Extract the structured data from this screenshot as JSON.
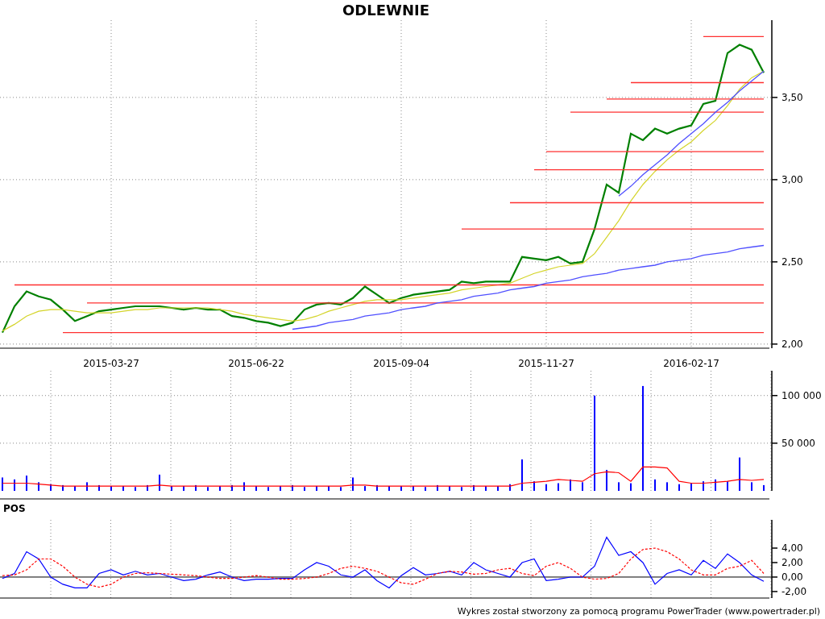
{
  "price_panel": {
    "chart_data": {
      "type": "line",
      "title": "ODLEWNIE",
      "grid": true,
      "categories": [
        null,
        null,
        null,
        null,
        null,
        null,
        null,
        null,
        null,
        "2015-03-27",
        null,
        null,
        null,
        null,
        null,
        null,
        null,
        null,
        null,
        null,
        null,
        "2015-06-22",
        null,
        null,
        null,
        null,
        null,
        null,
        null,
        null,
        null,
        null,
        null,
        "2015-09-04",
        null,
        null,
        null,
        null,
        null,
        null,
        null,
        null,
        null,
        null,
        null,
        "2015-11-27",
        null,
        null,
        null,
        null,
        null,
        null,
        null,
        null,
        null,
        null,
        null,
        "2016-02-17",
        null,
        null,
        null,
        null,
        null,
        null
      ],
      "ylim": [
        1.975,
        3.97
      ],
      "yticks": [
        {
          "value": 2,
          "label": "2,00"
        },
        {
          "value": 2.5,
          "label": "2,50"
        },
        {
          "value": 3,
          "label": "3,00"
        },
        {
          "value": 3.5,
          "label": "3,50"
        }
      ],
      "series": [
        {
          "color": "#008000",
          "values": [
            2.07,
            2.23,
            2.32,
            2.29,
            2.27,
            2.21,
            2.14,
            2.17,
            2.2,
            2.21,
            2.22,
            2.23,
            2.23,
            2.23,
            2.22,
            2.21,
            2.22,
            2.21,
            2.21,
            2.17,
            2.16,
            2.14,
            2.13,
            2.11,
            2.13,
            2.21,
            2.24,
            2.25,
            2.24,
            2.28,
            2.35,
            2.3,
            2.25,
            2.28,
            2.3,
            2.31,
            2.32,
            2.33,
            2.38,
            2.37,
            2.38,
            2.38,
            2.38,
            2.53,
            2.52,
            2.51,
            2.53,
            2.49,
            2.5,
            2.7,
            2.97,
            2.92,
            3.28,
            3.24,
            3.31,
            3.28,
            3.31,
            3.33,
            3.46,
            3.48,
            3.77,
            3.82,
            3.79,
            3.65
          ]
        },
        {
          "color": "#d4d42a",
          "values": [
            2.08,
            2.12,
            2.17,
            2.2,
            2.21,
            2.21,
            2.2,
            2.19,
            2.19,
            2.19,
            2.2,
            2.21,
            2.21,
            2.22,
            2.22,
            2.22,
            2.22,
            2.22,
            2.21,
            2.2,
            2.18,
            2.17,
            2.16,
            2.15,
            2.14,
            2.15,
            2.17,
            2.2,
            2.22,
            2.24,
            2.26,
            2.27,
            2.27,
            2.27,
            2.28,
            2.29,
            2.3,
            2.31,
            2.33,
            2.34,
            2.35,
            2.36,
            2.37,
            2.4,
            2.43,
            2.45,
            2.47,
            2.48,
            2.49,
            2.55,
            2.65,
            2.75,
            2.87,
            2.97,
            3.05,
            3.12,
            3.18,
            3.23,
            3.3,
            3.36,
            3.45,
            3.55,
            3.62,
            3.66
          ]
        },
        {
          "color": "#ff3030",
          "values": [
            null,
            null,
            null,
            null,
            null,
            null,
            null,
            null,
            null,
            null,
            null,
            null,
            null,
            null,
            null,
            null,
            null,
            null,
            null,
            null,
            null,
            null,
            null,
            null,
            null,
            null,
            null,
            null,
            null,
            null,
            null,
            null,
            null,
            null,
            null,
            null,
            null,
            null,
            null,
            null,
            null,
            null,
            null,
            null,
            null,
            null,
            null,
            null,
            null,
            null,
            null,
            null,
            null,
            null,
            null,
            null,
            null,
            null,
            3.87,
            3.87,
            3.87,
            3.87,
            3.87,
            3.87
          ]
        },
        {
          "color": "#ff3030",
          "values": [
            null,
            null,
            null,
            null,
            null,
            null,
            null,
            null,
            null,
            null,
            null,
            null,
            null,
            null,
            null,
            null,
            null,
            null,
            null,
            null,
            null,
            null,
            null,
            null,
            null,
            null,
            null,
            null,
            null,
            null,
            null,
            null,
            null,
            null,
            null,
            null,
            null,
            null,
            null,
            null,
            null,
            null,
            null,
            null,
            null,
            null,
            null,
            null,
            null,
            null,
            null,
            null,
            3.59,
            3.59,
            3.59,
            3.59,
            3.59,
            3.59,
            3.59,
            3.59,
            3.59,
            3.59,
            3.59,
            3.59
          ]
        },
        {
          "color": "#ff3030",
          "values": [
            null,
            null,
            null,
            null,
            null,
            null,
            null,
            null,
            null,
            null,
            null,
            null,
            null,
            null,
            null,
            null,
            null,
            null,
            null,
            null,
            null,
            null,
            null,
            null,
            null,
            null,
            null,
            null,
            null,
            null,
            null,
            null,
            null,
            null,
            null,
            null,
            null,
            null,
            null,
            null,
            null,
            null,
            null,
            null,
            null,
            null,
            null,
            null,
            null,
            null,
            3.49,
            3.49,
            3.49,
            3.49,
            3.49,
            3.49,
            3.49,
            3.49,
            3.49,
            3.49,
            3.49,
            3.49,
            3.49,
            3.49
          ]
        },
        {
          "color": "#ff3030",
          "values": [
            null,
            null,
            null,
            null,
            null,
            null,
            null,
            null,
            null,
            null,
            null,
            null,
            null,
            null,
            null,
            null,
            null,
            null,
            null,
            null,
            null,
            null,
            null,
            null,
            null,
            null,
            null,
            null,
            null,
            null,
            null,
            null,
            null,
            null,
            null,
            null,
            null,
            null,
            null,
            null,
            null,
            null,
            null,
            null,
            null,
            null,
            null,
            3.41,
            3.41,
            3.41,
            3.41,
            3.41,
            3.41,
            3.41,
            3.41,
            3.41,
            3.41,
            3.41,
            3.41,
            3.41,
            3.41,
            3.41,
            3.41,
            3.41
          ]
        },
        {
          "color": "#ff3030",
          "values": [
            null,
            null,
            null,
            null,
            null,
            null,
            null,
            null,
            null,
            null,
            null,
            null,
            null,
            null,
            null,
            null,
            null,
            null,
            null,
            null,
            null,
            null,
            null,
            null,
            null,
            null,
            null,
            null,
            null,
            null,
            null,
            null,
            null,
            null,
            null,
            null,
            null,
            null,
            null,
            null,
            null,
            null,
            null,
            null,
            null,
            3.17,
            3.17,
            3.17,
            3.17,
            3.17,
            3.17,
            3.17,
            3.17,
            3.17,
            3.17,
            3.17,
            3.17,
            3.17,
            3.17,
            3.17,
            3.17,
            3.17,
            3.17,
            3.17
          ]
        },
        {
          "color": "#ff3030",
          "values": [
            null,
            null,
            null,
            null,
            null,
            null,
            null,
            null,
            null,
            null,
            null,
            null,
            null,
            null,
            null,
            null,
            null,
            null,
            null,
            null,
            null,
            null,
            null,
            null,
            null,
            null,
            null,
            null,
            null,
            null,
            null,
            null,
            null,
            null,
            null,
            null,
            null,
            null,
            null,
            null,
            null,
            null,
            null,
            null,
            3.06,
            3.06,
            3.06,
            3.06,
            3.06,
            3.06,
            3.06,
            3.06,
            3.06,
            3.06,
            3.06,
            3.06,
            3.06,
            3.06,
            3.06,
            3.06,
            3.06,
            3.06,
            3.06,
            3.06
          ]
        },
        {
          "color": "#ff3030",
          "values": [
            null,
            null,
            null,
            null,
            null,
            null,
            null,
            null,
            null,
            null,
            null,
            null,
            null,
            null,
            null,
            null,
            null,
            null,
            null,
            null,
            null,
            null,
            null,
            null,
            null,
            null,
            null,
            null,
            null,
            null,
            null,
            null,
            null,
            null,
            null,
            null,
            null,
            null,
            null,
            null,
            null,
            null,
            2.86,
            2.86,
            2.86,
            2.86,
            2.86,
            2.86,
            2.86,
            2.86,
            2.86,
            2.86,
            2.86,
            2.86,
            2.86,
            2.86,
            2.86,
            2.86,
            2.86,
            2.86,
            2.86,
            2.86,
            2.86,
            2.86
          ]
        },
        {
          "color": "#ff3030",
          "values": [
            null,
            null,
            null,
            null,
            null,
            null,
            null,
            null,
            null,
            null,
            null,
            null,
            null,
            null,
            null,
            null,
            null,
            null,
            null,
            null,
            null,
            null,
            null,
            null,
            null,
            null,
            null,
            null,
            null,
            null,
            null,
            null,
            null,
            null,
            null,
            null,
            null,
            null,
            2.7,
            2.7,
            2.7,
            2.7,
            2.7,
            2.7,
            2.7,
            2.7,
            2.7,
            2.7,
            2.7,
            2.7,
            2.7,
            2.7,
            2.7,
            2.7,
            2.7,
            2.7,
            2.7,
            2.7,
            2.7,
            2.7,
            2.7,
            2.7,
            2.7,
            2.7
          ]
        },
        {
          "color": "#ff3030",
          "values": [
            null,
            2.36,
            2.36,
            2.36,
            2.36,
            2.36,
            2.36,
            2.36,
            2.36,
            2.36,
            2.36,
            2.36,
            2.36,
            2.36,
            2.36,
            2.36,
            2.36,
            2.36,
            2.36,
            2.36,
            2.36,
            2.36,
            2.36,
            2.36,
            2.36,
            2.36,
            2.36,
            2.36,
            2.36,
            2.36,
            2.36,
            2.36,
            2.36,
            2.36,
            2.36,
            2.36,
            2.36,
            2.36,
            2.36,
            2.36,
            2.36,
            2.36,
            2.36,
            2.36,
            2.36,
            2.36,
            2.36,
            2.36,
            2.36,
            2.36,
            2.36,
            2.36,
            2.36,
            2.36,
            2.36,
            2.36,
            2.36,
            2.36,
            2.36,
            2.36,
            2.36,
            2.36,
            2.36,
            2.36
          ]
        },
        {
          "color": "#ff3030",
          "values": [
            null,
            null,
            null,
            null,
            null,
            null,
            null,
            2.25,
            2.25,
            2.25,
            2.25,
            2.25,
            2.25,
            2.25,
            2.25,
            2.25,
            2.25,
            2.25,
            2.25,
            2.25,
            2.25,
            2.25,
            2.25,
            2.25,
            2.25,
            2.25,
            2.25,
            2.25,
            2.25,
            2.25,
            2.25,
            2.25,
            2.25,
            2.25,
            2.25,
            2.25,
            2.25,
            2.25,
            2.25,
            2.25,
            2.25,
            2.25,
            2.25,
            2.25,
            2.25,
            2.25,
            2.25,
            2.25,
            2.25,
            2.25,
            2.25,
            2.25,
            2.25,
            2.25,
            2.25,
            2.25,
            2.25,
            2.25,
            2.25,
            2.25,
            2.25,
            2.25,
            2.25,
            2.25
          ]
        },
        {
          "color": "#ff3030",
          "values": [
            null,
            null,
            null,
            null,
            null,
            2.07,
            2.07,
            2.07,
            2.07,
            2.07,
            2.07,
            2.07,
            2.07,
            2.07,
            2.07,
            2.07,
            2.07,
            2.07,
            2.07,
            2.07,
            2.07,
            2.07,
            2.07,
            2.07,
            2.07,
            2.07,
            2.07,
            2.07,
            2.07,
            2.07,
            2.07,
            2.07,
            2.07,
            2.07,
            2.07,
            2.07,
            2.07,
            2.07,
            2.07,
            2.07,
            2.07,
            2.07,
            2.07,
            2.07,
            2.07,
            2.07,
            2.07,
            2.07,
            2.07,
            2.07,
            2.07,
            2.07,
            2.07,
            2.07,
            2.07,
            2.07,
            2.07,
            2.07,
            2.07,
            2.07,
            2.07,
            2.07,
            2.07,
            2.07
          ]
        },
        {
          "color": "#5050ff",
          "values": [
            null,
            null,
            null,
            null,
            null,
            null,
            null,
            null,
            null,
            null,
            null,
            null,
            null,
            null,
            null,
            null,
            null,
            null,
            null,
            null,
            null,
            null,
            null,
            null,
            2.09,
            2.1,
            2.11,
            2.13,
            2.14,
            2.15,
            2.17,
            2.18,
            2.19,
            2.21,
            2.22,
            2.23,
            2.25,
            2.26,
            2.27,
            2.29,
            2.3,
            2.31,
            2.33,
            2.34,
            2.35,
            2.37,
            2.38,
            2.39,
            2.41,
            2.42,
            2.43,
            2.45,
            2.46,
            2.47,
            2.48,
            2.5,
            2.51,
            2.52,
            2.54,
            2.55,
            2.56,
            2.58,
            2.59,
            2.6
          ]
        },
        {
          "color": "#5050ff",
          "values": [
            null,
            null,
            null,
            null,
            null,
            null,
            null,
            null,
            null,
            null,
            null,
            null,
            null,
            null,
            null,
            null,
            null,
            null,
            null,
            null,
            null,
            null,
            null,
            null,
            null,
            null,
            null,
            null,
            null,
            null,
            null,
            null,
            null,
            null,
            null,
            null,
            null,
            null,
            null,
            null,
            null,
            null,
            null,
            null,
            null,
            null,
            null,
            null,
            null,
            null,
            null,
            2.9,
            2.96,
            3.03,
            3.09,
            3.15,
            3.22,
            3.28,
            3.34,
            3.41,
            3.47,
            3.54,
            3.6,
            3.66
          ]
        }
      ]
    }
  },
  "volume_panel": {
    "chart_data": {
      "type": "bar",
      "grid": true,
      "ylim": [
        0,
        126000
      ],
      "categories": [
        null,
        null,
        null,
        null,
        null,
        null,
        null,
        null,
        null,
        null,
        null,
        null,
        null,
        null,
        null,
        null,
        null,
        null,
        null,
        null,
        null,
        null,
        null,
        null,
        null,
        null,
        null,
        null,
        null,
        null,
        null,
        null,
        null,
        null,
        null,
        null,
        null,
        null,
        null,
        null,
        null,
        null,
        null,
        null,
        null,
        null,
        null,
        null,
        null,
        null,
        null,
        null,
        null,
        null,
        null,
        null,
        null,
        null,
        null,
        null,
        null,
        null,
        null,
        null
      ],
      "yticks": [
        {
          "value": 50000,
          "label": "50 000"
        },
        {
          "value": 100000,
          "label": "100 000"
        }
      ],
      "series": [
        {
          "color": "#0000ff",
          "values": [
            14000,
            12000,
            16000,
            9000,
            7000,
            6000,
            5000,
            9000,
            6000,
            5000,
            5000,
            4000,
            6000,
            17000,
            5000,
            5000,
            6000,
            4000,
            5000,
            6000,
            9000,
            5000,
            4000,
            5000,
            6000,
            4000,
            5000,
            5000,
            4000,
            14000,
            5000,
            6000,
            5000,
            5000,
            5000,
            4000,
            6000,
            5000,
            4000,
            6000,
            5000,
            5000,
            7000,
            33000,
            10000,
            7000,
            8000,
            12000,
            9000,
            100000,
            22000,
            9000,
            8000,
            110000,
            12000,
            9000,
            7000,
            8000,
            10000,
            12000,
            10000,
            35000,
            9000,
            6000
          ]
        },
        {
          "type": "line",
          "color": "#ff0000",
          "values": [
            8000,
            8000,
            8000,
            7000,
            6000,
            5000,
            5000,
            5000,
            5000,
            5000,
            5000,
            5000,
            5000,
            6000,
            5000,
            5000,
            5000,
            5000,
            5000,
            5000,
            5000,
            5000,
            5000,
            5000,
            5000,
            5000,
            5000,
            5000,
            5000,
            6000,
            6000,
            5000,
            5000,
            5000,
            5000,
            5000,
            5000,
            5000,
            5000,
            5000,
            5000,
            5000,
            5000,
            8000,
            9000,
            10000,
            12000,
            11000,
            10000,
            18000,
            20000,
            19000,
            10000,
            25000,
            25000,
            24000,
            10000,
            8000,
            8000,
            9000,
            10000,
            12000,
            11000,
            12000
          ]
        }
      ]
    }
  },
  "pos_panel": {
    "chart_data": {
      "type": "line",
      "title": "POS",
      "grid": true,
      "ylim": [
        -2.9,
        7.9
      ],
      "categories": [
        null,
        null,
        null,
        null,
        null,
        null,
        null,
        null,
        null,
        null,
        null,
        null,
        null,
        null,
        null,
        null,
        null,
        null,
        null,
        null,
        null,
        null,
        null,
        null,
        null,
        null,
        null,
        null,
        null,
        null,
        null,
        null,
        null,
        null,
        null,
        null,
        null,
        null,
        null,
        null,
        null,
        null,
        null,
        null,
        null,
        null,
        null,
        null,
        null,
        null,
        null,
        null,
        null,
        null,
        null,
        null,
        null,
        null,
        null,
        null,
        null,
        null,
        null,
        null
      ],
      "yticks": [
        {
          "value": -2,
          "label": "-2,00"
        },
        {
          "value": 0,
          "label": "0,00"
        },
        {
          "value": 2,
          "label": "2,00"
        },
        {
          "value": 4,
          "label": "4,00"
        }
      ],
      "series": [
        {
          "color": "#0000ff",
          "values": [
            -0.2,
            0.5,
            3.5,
            2.5,
            0,
            -1.0,
            -1.5,
            -1.5,
            0.5,
            1.0,
            0.3,
            0.8,
            0.3,
            0.5,
            0,
            -0.5,
            -0.3,
            0.3,
            0.7,
            0,
            -0.5,
            -0.3,
            -0.3,
            -0.2,
            -0.2,
            1.0,
            2.0,
            1.5,
            0.3,
            0,
            1.0,
            -0.5,
            -1.5,
            0.2,
            1.3,
            0.3,
            0.5,
            0.8,
            0.3,
            2.0,
            1.0,
            0.5,
            0,
            2.0,
            2.5,
            -0.5,
            -0.3,
            0,
            0,
            1.5,
            5.5,
            3.0,
            3.5,
            2.0,
            -1.0,
            0.5,
            1.0,
            0.3,
            2.3,
            1.2,
            3.2,
            2.0,
            0.3,
            -0.6
          ]
        },
        {
          "color": "#ff0000",
          "line_style": "dashed",
          "values": [
            0.2,
            0.3,
            1.0,
            2.5,
            2.5,
            1.5,
            0,
            -1.0,
            -1.4,
            -1.0,
            0,
            0.5,
            0.6,
            0.5,
            0.4,
            0.3,
            0.2,
            0,
            -0.2,
            -0.2,
            0,
            0.2,
            0,
            -0.3,
            -0.3,
            -0.2,
            0,
            0.5,
            1.2,
            1.5,
            1.2,
            0.8,
            0,
            -0.8,
            -1.0,
            -0.3,
            0.5,
            0.8,
            0.7,
            0.4,
            0.5,
            1.0,
            1.2,
            0.5,
            0.2,
            1.5,
            2.0,
            1.2,
            0,
            -0.3,
            -0.2,
            0.5,
            2.5,
            3.8,
            4.0,
            3.5,
            2.5,
            1.0,
            0.3,
            0.3,
            1.2,
            1.5,
            2.3,
            0.5
          ]
        }
      ]
    }
  },
  "footer": "Wykres został stworzony za pomocą programu PowerTrader (www.powertrader.pl)"
}
